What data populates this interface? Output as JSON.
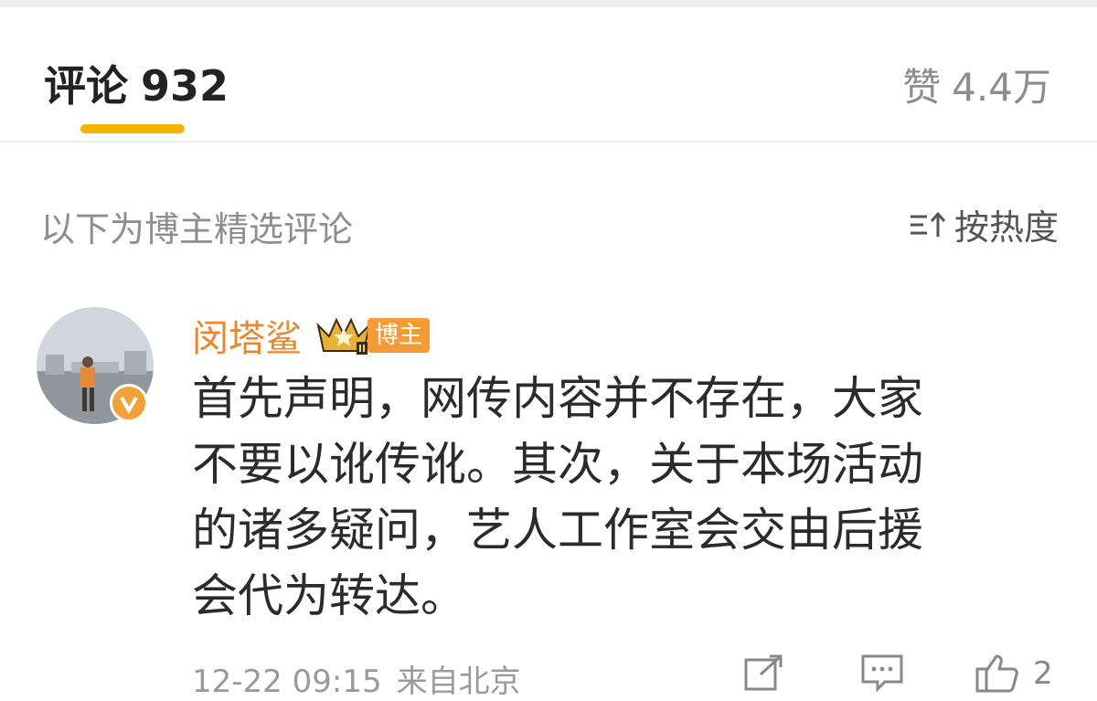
{
  "tabs": {
    "comments_label": "评论",
    "comments_count": "932",
    "likes_label": "赞",
    "likes_count": "4.4万"
  },
  "filter": {
    "label": "以下为博主精选评论",
    "sort_label": "按热度"
  },
  "comment": {
    "author": "闵塔鲨",
    "badge": "博主",
    "lines": [
      "首先声明，网传内容并不存在，大家",
      "不要以讹传讹。其次，关于本场活动",
      "的诸多疑问，艺人工作室会交由后援",
      "会代为转达。"
    ],
    "date": "12-22 09:15",
    "location": "来自北京",
    "like_count": "2"
  },
  "icons": {
    "sort": "sort-icon",
    "crown": "crown-level-icon",
    "verified": "verified-v-icon",
    "share": "share-icon",
    "reply": "comment-icon",
    "like": "thumbs-up-icon"
  },
  "colors": {
    "accent": "#f4b400",
    "author": "#e8872e",
    "badge": "#f49b37",
    "text": "#2b2b2b",
    "muted": "#9a9a9a"
  }
}
